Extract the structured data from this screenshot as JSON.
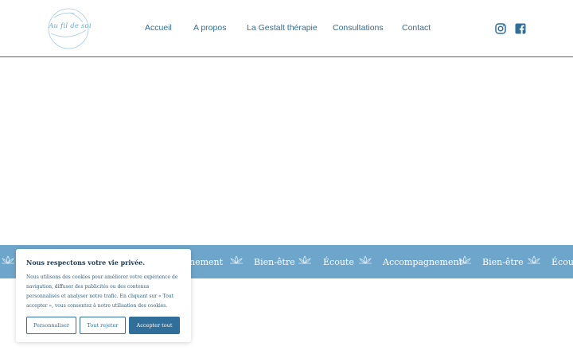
{
  "brand": {
    "logo_text": "Au fil de soi"
  },
  "nav": {
    "items": [
      {
        "label": "Accueil"
      },
      {
        "label": "A propos"
      },
      {
        "label": "La Gestalt thérapie"
      },
      {
        "label": "Consultations"
      },
      {
        "label": "Contact"
      }
    ]
  },
  "social": {
    "icons": [
      "instagram-icon",
      "facebook-icon"
    ]
  },
  "ribbon": {
    "items": [
      "nement",
      "Bien-être",
      "Écoute",
      "Accompagnement",
      "Bien-être",
      "Écoute"
    ]
  },
  "cookie": {
    "title": "Nous respectons votre vie privée.",
    "text": "Nous utilisons des cookies pour améliorer votre expérience de navigation, diffuser des publicités ou des contenus personnalisés et analyser notre trafic. En cliquant sur « Tout accepter », vous consentez à notre utilisation des cookies.",
    "customize_label": "Personnaliser",
    "reject_label": "Tout rejeter",
    "accept_label": "Accepter tout"
  },
  "colors": {
    "accent": "#2f6f9a",
    "ribbon": "#6ea6cb",
    "light": "#6aa8c9"
  }
}
